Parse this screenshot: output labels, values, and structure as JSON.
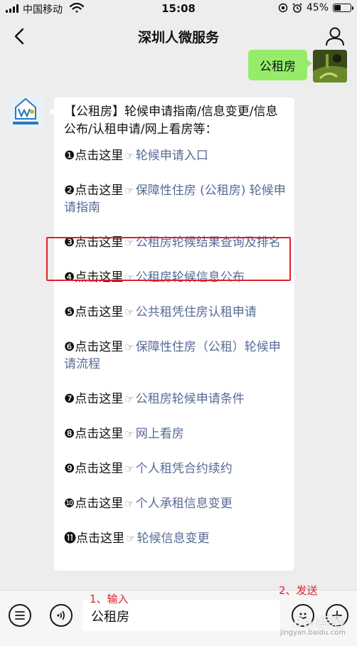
{
  "status_bar": {
    "carrier": "中国移动",
    "time": "15:08",
    "battery": "45%",
    "battery_level": 0.45
  },
  "nav": {
    "title": "深圳人微服务"
  },
  "messages": {
    "outgoing": {
      "text": "公租房"
    },
    "incoming": {
      "intro": "【公租房】轮候申请指南/信息变更/信息公布/认租申请/网上看房等：",
      "items": [
        {
          "num": "❶",
          "prefix": "点击这里",
          "link": "轮候申请入口"
        },
        {
          "num": "❷",
          "prefix": "点击这里",
          "link": "保障性住房 (公租房) 轮候申请指南"
        },
        {
          "num": "❸",
          "prefix": "点击这里",
          "link": "公租房轮候结果查询及排名"
        },
        {
          "num": "❹",
          "prefix": "点击这里",
          "link": "公租房轮候信息公布"
        },
        {
          "num": "❺",
          "prefix": "点击这里",
          "link": "公共租凭住房认租申请"
        },
        {
          "num": "❻",
          "prefix": "点击这里",
          "link": "保障性住房（公租）轮候申请流程"
        },
        {
          "num": "❼",
          "prefix": "点击这里",
          "link": "公租房轮候申请条件"
        },
        {
          "num": "❽",
          "prefix": "点击这里",
          "link": "网上看房"
        },
        {
          "num": "❾",
          "prefix": "点击这里",
          "link": "个人租凭合约续约"
        },
        {
          "num": "❿",
          "prefix": "点击这里",
          "link": "个人承租信息变更"
        },
        {
          "num": "⓫",
          "prefix": "点击这里",
          "link": "轮候信息变更"
        }
      ]
    }
  },
  "input_bar": {
    "value": "公租房"
  },
  "annotations": {
    "step1": "1、输入",
    "step2": "2、发送",
    "highlight_color": "#e0202a"
  },
  "watermark": {
    "text": "Bai经验",
    "sub": "jingyan.baidu.com"
  },
  "icons": {
    "hand": "☞"
  }
}
